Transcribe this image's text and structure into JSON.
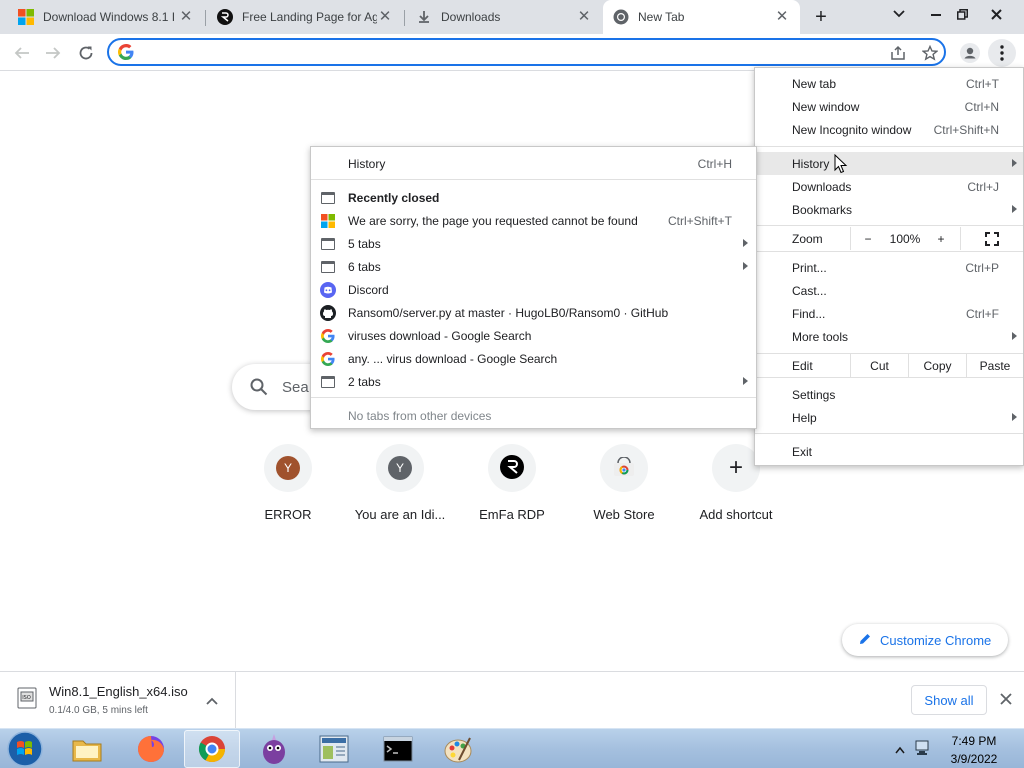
{
  "tabs": [
    {
      "title": "Download Windows 8.1 I",
      "icon": "windows-logo-icon",
      "close": "✕"
    },
    {
      "title": "Free Landing Page for Ag",
      "icon": "emfa-logo-icon",
      "close": "✕"
    },
    {
      "title": "Downloads",
      "icon": "download-icon",
      "close": "✕"
    },
    {
      "title": "New Tab",
      "icon": "chrome-icon",
      "close": "✕",
      "active": true
    }
  ],
  "new_tab_symbol": "+",
  "omnibox": {
    "value": "",
    "placeholder": ""
  },
  "ntp": {
    "search_placeholder": "Sea",
    "shortcuts": [
      {
        "label": "ERROR",
        "letter": "Y",
        "color": "#a0522d"
      },
      {
        "label": "You are an Idi...",
        "letter": "Y",
        "color": "#5f6368"
      },
      {
        "label": "EmFa RDP",
        "letter": "",
        "color": "#000000"
      },
      {
        "label": "Web Store",
        "letter": "",
        "color": ""
      },
      {
        "label": "Add shortcut",
        "letter": "+",
        "color": ""
      }
    ],
    "customize_label": "Customize Chrome"
  },
  "main_menu": {
    "new_tab": {
      "label": "New tab",
      "shortcut": "Ctrl+T"
    },
    "new_window": {
      "label": "New window",
      "shortcut": "Ctrl+N"
    },
    "new_incognito": {
      "label": "New Incognito window",
      "shortcut": "Ctrl+Shift+N"
    },
    "history": {
      "label": "History"
    },
    "downloads": {
      "label": "Downloads",
      "shortcut": "Ctrl+J"
    },
    "bookmarks": {
      "label": "Bookmarks"
    },
    "zoom": {
      "label": "Zoom",
      "minus": "−",
      "value": "100%",
      "plus": "+"
    },
    "print": {
      "label": "Print...",
      "shortcut": "Ctrl+P"
    },
    "cast": {
      "label": "Cast..."
    },
    "find": {
      "label": "Find...",
      "shortcut": "Ctrl+F"
    },
    "more_tools": {
      "label": "More tools"
    },
    "edit": {
      "label": "Edit",
      "cut": "Cut",
      "copy": "Copy",
      "paste": "Paste"
    },
    "settings": {
      "label": "Settings"
    },
    "help": {
      "label": "Help"
    },
    "exit": {
      "label": "Exit"
    }
  },
  "history_menu": {
    "history": {
      "label": "History",
      "shortcut": "Ctrl+H"
    },
    "recently_closed": "Recently closed",
    "items": [
      {
        "label": "We are sorry, the page you requested cannot be found",
        "shortcut": "Ctrl+Shift+T",
        "icon": "windows-logo-icon",
        "submenu": false
      },
      {
        "label": "5 tabs",
        "shortcut": "",
        "icon": "tab-window-icon",
        "submenu": true
      },
      {
        "label": "6 tabs",
        "shortcut": "",
        "icon": "tab-window-icon",
        "submenu": true
      },
      {
        "label": "Discord",
        "shortcut": "",
        "icon": "discord-icon",
        "submenu": false
      },
      {
        "label": "Ransom0/server.py at master · HugoLB0/Ransom0 · GitHub",
        "shortcut": "",
        "icon": "github-icon",
        "submenu": false
      },
      {
        "label": "viruses download - Google Search",
        "shortcut": "",
        "icon": "google-icon",
        "submenu": false
      },
      {
        "label": "any. ... virus download - Google Search",
        "shortcut": "",
        "icon": "google-icon",
        "submenu": false
      },
      {
        "label": "2 tabs",
        "shortcut": "",
        "icon": "tab-window-icon",
        "submenu": true
      }
    ],
    "no_other_devices": "No tabs from other devices"
  },
  "download_shelf": {
    "file_name": "Win8.1_English_x64.iso",
    "status": "0.1/4.0 GB, 5 mins left",
    "show_all": "Show all"
  },
  "taskbar": {
    "time": "7:49 PM",
    "date": "3/9/2022"
  },
  "colors": {
    "accent": "#1a73e8",
    "tabstrip": "#dee1e6",
    "taskbar": "#a5c0df"
  }
}
